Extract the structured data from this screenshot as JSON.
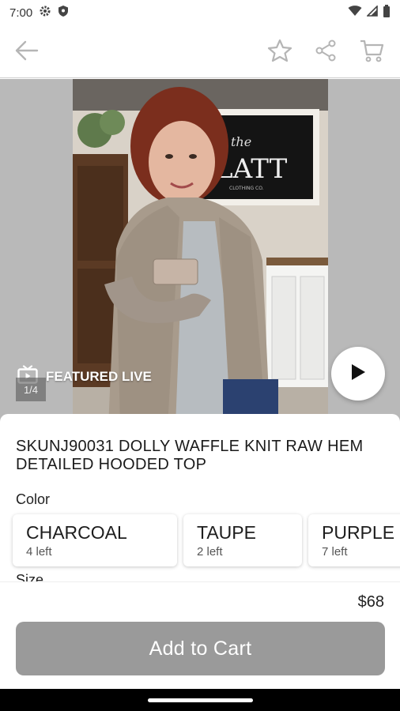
{
  "status_bar": {
    "time": "7:00"
  },
  "hero": {
    "featured_label": "FEATURED LIVE",
    "counter": "1/4",
    "sign_text_1": "the",
    "sign_text_2": "LATT",
    "sign_text_3": "CLOTHING CO."
  },
  "product": {
    "title": "SKUNJ90031 DOLLY WAFFLE KNIT RAW HEM DETAILED HOODED TOP",
    "color_label": "Color",
    "colors": [
      {
        "name": "CHARCOAL",
        "stock": "4 left"
      },
      {
        "name": "TAUPE",
        "stock": "2 left"
      },
      {
        "name": "PURPLE",
        "stock": "7 left"
      }
    ],
    "size_label": "Size",
    "price": "$68"
  },
  "actions": {
    "add_to_cart": "Add to Cart"
  },
  "colors": {
    "button_bg": "#9a9a9a",
    "hero_bg": "#b9b9b9"
  }
}
